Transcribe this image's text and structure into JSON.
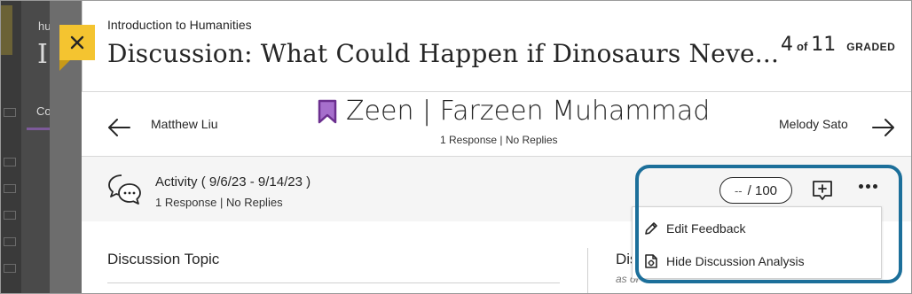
{
  "background": {
    "crumb": "hu",
    "big_letter": "I",
    "tab_label": "Co"
  },
  "panel": {
    "close_label": "Close",
    "course_name": "Introduction to Humanities",
    "title": "Discussion: What Could Happen if Dinosaurs Neve...",
    "counter": {
      "current": "4",
      "of": "of",
      "total": "11",
      "status": "GRADED"
    }
  },
  "student_nav": {
    "previous_student": "Matthew Liu",
    "next_student": "Melody Sato",
    "current_student": "Zeen | Farzeen Muhammad",
    "current_summary": "1 Response | No Replies",
    "bookmark_color": "#8a4fb0"
  },
  "activity": {
    "label": "Activity",
    "date_range": "( 9/6/23 - 9/14/23 )",
    "summary": "1 Response | No Replies",
    "grade_placeholder": "--",
    "grade_max": "/ 100",
    "feedback_icon": "add-feedback-icon",
    "more_icon": "more-options-icon"
  },
  "menu": {
    "items": [
      {
        "label": "Edit Feedback",
        "icon": "pencil-icon"
      },
      {
        "label": "Hide Discussion Analysis",
        "icon": "analysis-icon"
      }
    ]
  },
  "content": {
    "topic_heading": "Discussion Topic",
    "side_heading": "Dis",
    "side_sub": "as of"
  },
  "colors": {
    "close_button": "#f4c430",
    "highlight_ring": "#1c6f9a",
    "text": "#262626"
  }
}
